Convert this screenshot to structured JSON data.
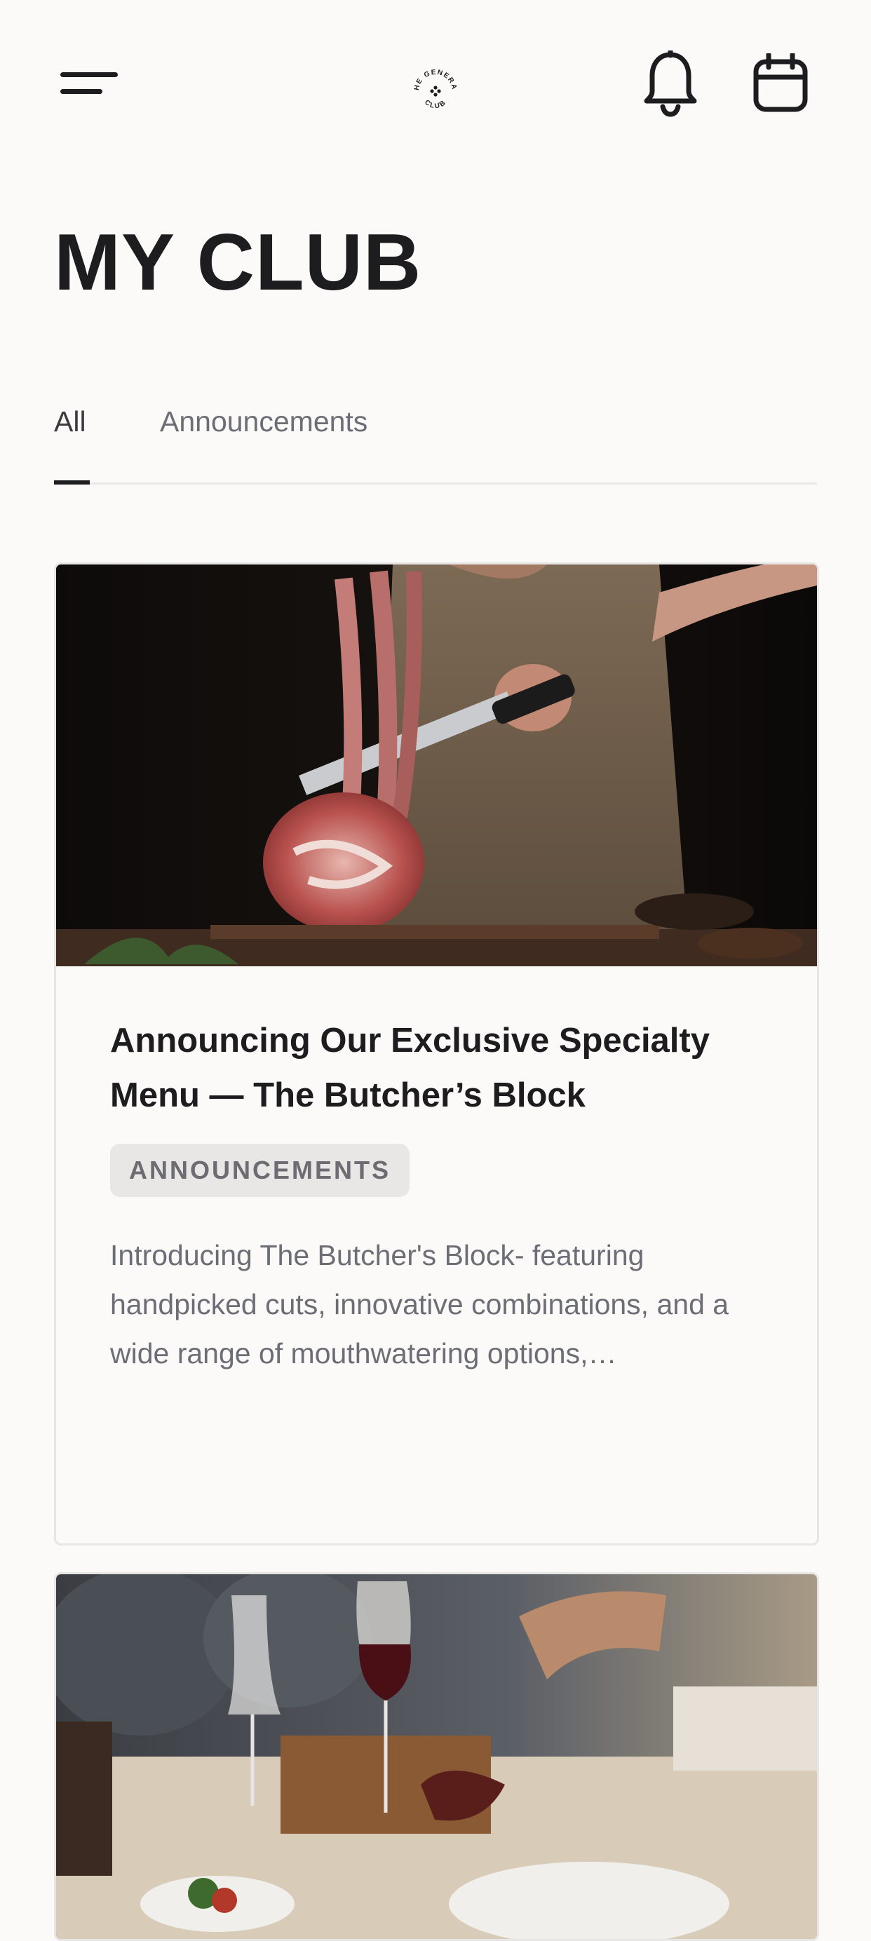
{
  "header": {
    "logo_text": "THE GENERAL CLUB",
    "icons": [
      "hamburger-menu-icon",
      "logo",
      "bell-icon",
      "calendar-icon"
    ]
  },
  "page": {
    "title": "MY CLUB"
  },
  "tabs": [
    {
      "label": "All",
      "active": true
    },
    {
      "label": "Announcements",
      "active": false
    }
  ],
  "cards": [
    {
      "title": "Announcing Our Exclusive Specialty Menu — The Butcher’s Block",
      "badge": "ANNOUNCEMENTS",
      "excerpt": "Introducing The Butcher's Block- featuring handpicked cuts, innovative combinations, and a wide range of mouthwatering options,…"
    }
  ],
  "colors": {
    "background": "#fbfaf9",
    "text_primary": "#1d1d1f",
    "text_secondary": "#6d6d75",
    "badge_bg": "#e8e7e6"
  }
}
